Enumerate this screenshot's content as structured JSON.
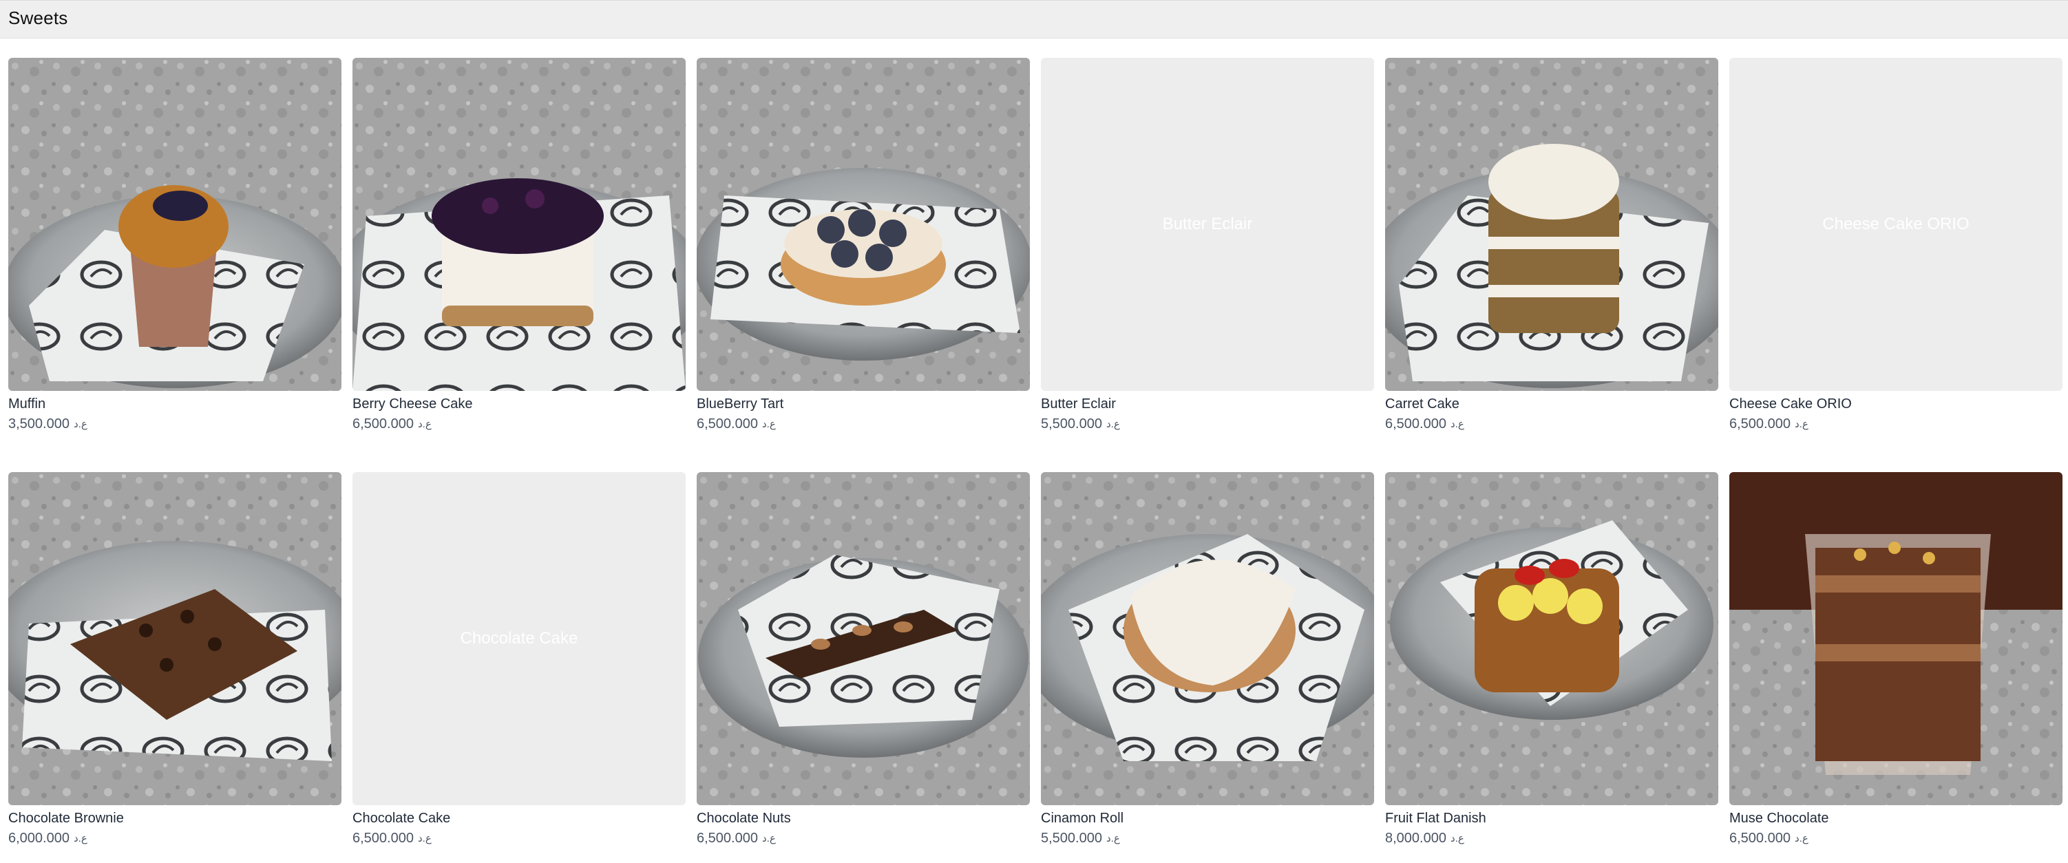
{
  "section": {
    "title": "Sweets"
  },
  "colors": {
    "header_bg": "#efefef",
    "placeholder_bg": "#ededed",
    "text": "#1f2937",
    "price_text": "#4b5563"
  },
  "products": [
    {
      "name": "Muffin",
      "price": "3,500.000",
      "currency": "ع.د",
      "has_image": true,
      "image_icon": "muffin-photo"
    },
    {
      "name": "Berry Cheese Cake",
      "price": "6,500.000",
      "currency": "ع.د",
      "has_image": true,
      "image_icon": "cheesecake-photo"
    },
    {
      "name": "BlueBerry Tart",
      "price": "6,500.000",
      "currency": "ع.د",
      "has_image": true,
      "image_icon": "tart-photo"
    },
    {
      "name": "Butter Eclair",
      "price": "5,500.000",
      "currency": "ع.د",
      "has_image": false,
      "placeholder": "Butter Eclair"
    },
    {
      "name": "Carret Cake",
      "price": "6,500.000",
      "currency": "ع.د",
      "has_image": true,
      "image_icon": "layer-cake-photo"
    },
    {
      "name": "Cheese Cake ORIO",
      "price": "6,500.000",
      "currency": "ع.د",
      "has_image": false,
      "placeholder": "Cheese Cake ORIO"
    },
    {
      "name": "Chocolate Brownie",
      "price": "6,000.000",
      "currency": "ع.د",
      "has_image": true,
      "image_icon": "brownie-photo"
    },
    {
      "name": "Chocolate Cake",
      "price": "6,500.000",
      "currency": "ع.د",
      "has_image": false,
      "placeholder": "Chocolate Cake"
    },
    {
      "name": "Chocolate Nuts",
      "price": "6,500.000",
      "currency": "ع.د",
      "has_image": true,
      "image_icon": "chocolate-nuts-photo"
    },
    {
      "name": "Cinamon Roll",
      "price": "5,500.000",
      "currency": "ع.د",
      "has_image": true,
      "image_icon": "cinnamon-roll-photo"
    },
    {
      "name": "Fruit Flat Danish",
      "price": "8,000.000",
      "currency": "ع.د",
      "has_image": true,
      "image_icon": "danish-photo"
    },
    {
      "name": "Muse Chocolate",
      "price": "6,500.000",
      "currency": "ع.د",
      "has_image": true,
      "image_icon": "chocolate-cup-photo"
    }
  ]
}
